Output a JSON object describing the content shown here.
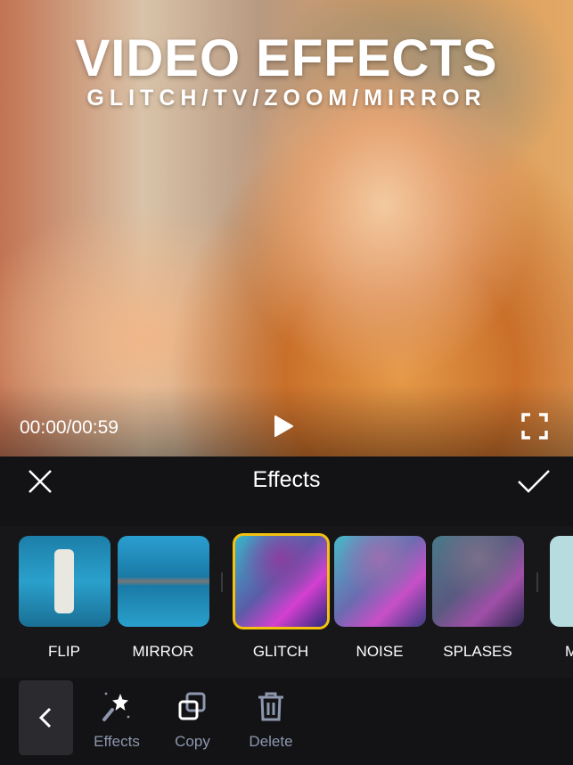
{
  "promo": {
    "title": "VIDEO EFFECTS",
    "subtitle": "GLITCH/TV/ZOOM/MIRROR"
  },
  "player": {
    "time": "00:00/00:59",
    "play_icon": "play-icon",
    "fullscreen_icon": "fullscreen-icon"
  },
  "header": {
    "title": "Effects",
    "close_icon": "close-icon",
    "confirm_icon": "checkmark-icon"
  },
  "effects": [
    {
      "label": "FLIP",
      "selected": false
    },
    {
      "label": "MIRROR",
      "selected": false
    },
    {
      "label": "GLITCH",
      "selected": true
    },
    {
      "label": "NOISE",
      "selected": false
    },
    {
      "label": "SPLASES",
      "selected": false
    },
    {
      "label": "M",
      "selected": false
    }
  ],
  "toolbar": {
    "back_icon": "chevron-left-icon",
    "items": [
      {
        "label": "Effects",
        "icon": "magic-wand-icon"
      },
      {
        "label": "Copy",
        "icon": "copy-icon"
      },
      {
        "label": "Delete",
        "icon": "trash-icon"
      }
    ]
  },
  "colors": {
    "selected_border": "#f4c20d",
    "background": "#131315",
    "toolbar_text": "#8d97ad"
  }
}
